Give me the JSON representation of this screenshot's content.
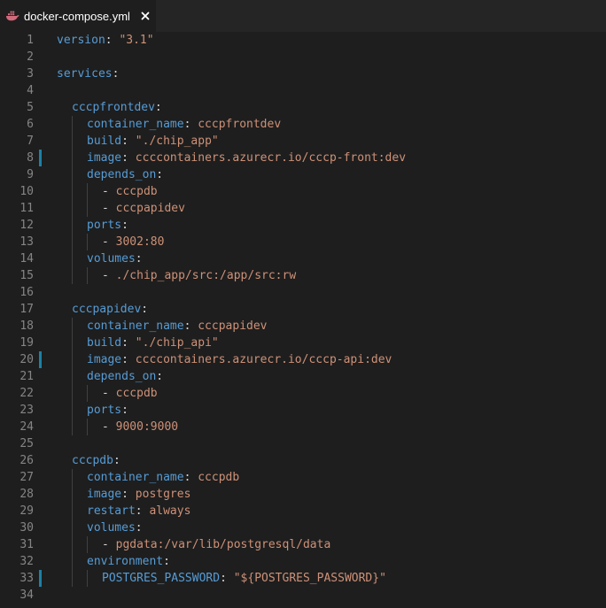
{
  "tab": {
    "filename": "docker-compose.yml",
    "icon": "docker-whale-icon",
    "close_glyph": "✕"
  },
  "colors": {
    "background": "#1e1e1e",
    "key": "#569cd6",
    "string": "#ce9178",
    "line_number": "#858585",
    "git_modified": "#1b81a8"
  },
  "lines": [
    {
      "n": "1",
      "indent": 0,
      "key": "version",
      "sep": ": ",
      "val": "\"3.1\"",
      "dash": false,
      "mod": false
    },
    {
      "n": "2",
      "indent": 0,
      "key": "",
      "sep": "",
      "val": "",
      "dash": false,
      "mod": false
    },
    {
      "n": "3",
      "indent": 0,
      "key": "services",
      "sep": ":",
      "val": "",
      "dash": false,
      "mod": false
    },
    {
      "n": "4",
      "indent": 0,
      "key": "",
      "sep": "",
      "val": "",
      "dash": false,
      "mod": false
    },
    {
      "n": "5",
      "indent": 1,
      "key": "cccpfrontdev",
      "sep": ":",
      "val": "",
      "dash": false,
      "mod": false
    },
    {
      "n": "6",
      "indent": 2,
      "key": "container_name",
      "sep": ": ",
      "val": "cccpfrontdev",
      "dash": false,
      "mod": false
    },
    {
      "n": "7",
      "indent": 2,
      "key": "build",
      "sep": ": ",
      "val": "\"./chip_app\"",
      "dash": false,
      "mod": false
    },
    {
      "n": "8",
      "indent": 2,
      "key": "image",
      "sep": ": ",
      "val": "ccccontainers.azurecr.io/cccp-front:dev",
      "dash": false,
      "mod": true
    },
    {
      "n": "9",
      "indent": 2,
      "key": "depends_on",
      "sep": ":",
      "val": "",
      "dash": false,
      "mod": false
    },
    {
      "n": "10",
      "indent": 3,
      "key": "",
      "sep": "",
      "val": "cccpdb",
      "dash": true,
      "mod": false
    },
    {
      "n": "11",
      "indent": 3,
      "key": "",
      "sep": "",
      "val": "cccpapidev",
      "dash": true,
      "mod": false
    },
    {
      "n": "12",
      "indent": 2,
      "key": "ports",
      "sep": ":",
      "val": "",
      "dash": false,
      "mod": false
    },
    {
      "n": "13",
      "indent": 3,
      "key": "",
      "sep": "",
      "val": "3002:80",
      "dash": true,
      "mod": false
    },
    {
      "n": "14",
      "indent": 2,
      "key": "volumes",
      "sep": ":",
      "val": "",
      "dash": false,
      "mod": false
    },
    {
      "n": "15",
      "indent": 3,
      "key": "",
      "sep": "",
      "val": "./chip_app/src:/app/src:rw",
      "dash": true,
      "mod": false
    },
    {
      "n": "16",
      "indent": 0,
      "key": "",
      "sep": "",
      "val": "",
      "dash": false,
      "mod": false
    },
    {
      "n": "17",
      "indent": 1,
      "key": "cccpapidev",
      "sep": ":",
      "val": "",
      "dash": false,
      "mod": false
    },
    {
      "n": "18",
      "indent": 2,
      "key": "container_name",
      "sep": ": ",
      "val": "cccpapidev",
      "dash": false,
      "mod": false
    },
    {
      "n": "19",
      "indent": 2,
      "key": "build",
      "sep": ": ",
      "val": "\"./chip_api\"",
      "dash": false,
      "mod": false
    },
    {
      "n": "20",
      "indent": 2,
      "key": "image",
      "sep": ": ",
      "val": "ccccontainers.azurecr.io/cccp-api:dev",
      "dash": false,
      "mod": true
    },
    {
      "n": "21",
      "indent": 2,
      "key": "depends_on",
      "sep": ":",
      "val": "",
      "dash": false,
      "mod": false
    },
    {
      "n": "22",
      "indent": 3,
      "key": "",
      "sep": "",
      "val": "cccpdb",
      "dash": true,
      "mod": false
    },
    {
      "n": "23",
      "indent": 2,
      "key": "ports",
      "sep": ":",
      "val": "",
      "dash": false,
      "mod": false
    },
    {
      "n": "24",
      "indent": 3,
      "key": "",
      "sep": "",
      "val": "9000:9000",
      "dash": true,
      "mod": false
    },
    {
      "n": "25",
      "indent": 0,
      "key": "",
      "sep": "",
      "val": "",
      "dash": false,
      "mod": false
    },
    {
      "n": "26",
      "indent": 1,
      "key": "cccpdb",
      "sep": ":",
      "val": "",
      "dash": false,
      "mod": false
    },
    {
      "n": "27",
      "indent": 2,
      "key": "container_name",
      "sep": ": ",
      "val": "cccpdb",
      "dash": false,
      "mod": false
    },
    {
      "n": "28",
      "indent": 2,
      "key": "image",
      "sep": ": ",
      "val": "postgres",
      "dash": false,
      "mod": false
    },
    {
      "n": "29",
      "indent": 2,
      "key": "restart",
      "sep": ": ",
      "val": "always",
      "dash": false,
      "mod": false
    },
    {
      "n": "30",
      "indent": 2,
      "key": "volumes",
      "sep": ":",
      "val": "",
      "dash": false,
      "mod": false
    },
    {
      "n": "31",
      "indent": 3,
      "key": "",
      "sep": "",
      "val": "pgdata:/var/lib/postgresql/data",
      "dash": true,
      "mod": false
    },
    {
      "n": "32",
      "indent": 2,
      "key": "environment",
      "sep": ":",
      "val": "",
      "dash": false,
      "mod": false
    },
    {
      "n": "33",
      "indent": 3,
      "key": "POSTGRES_PASSWORD",
      "sep": ": ",
      "val": "\"${POSTGRES_PASSWORD}\"",
      "dash": false,
      "mod": true
    },
    {
      "n": "34",
      "indent": 0,
      "key": "",
      "sep": "",
      "val": "",
      "dash": false,
      "mod": false
    }
  ]
}
